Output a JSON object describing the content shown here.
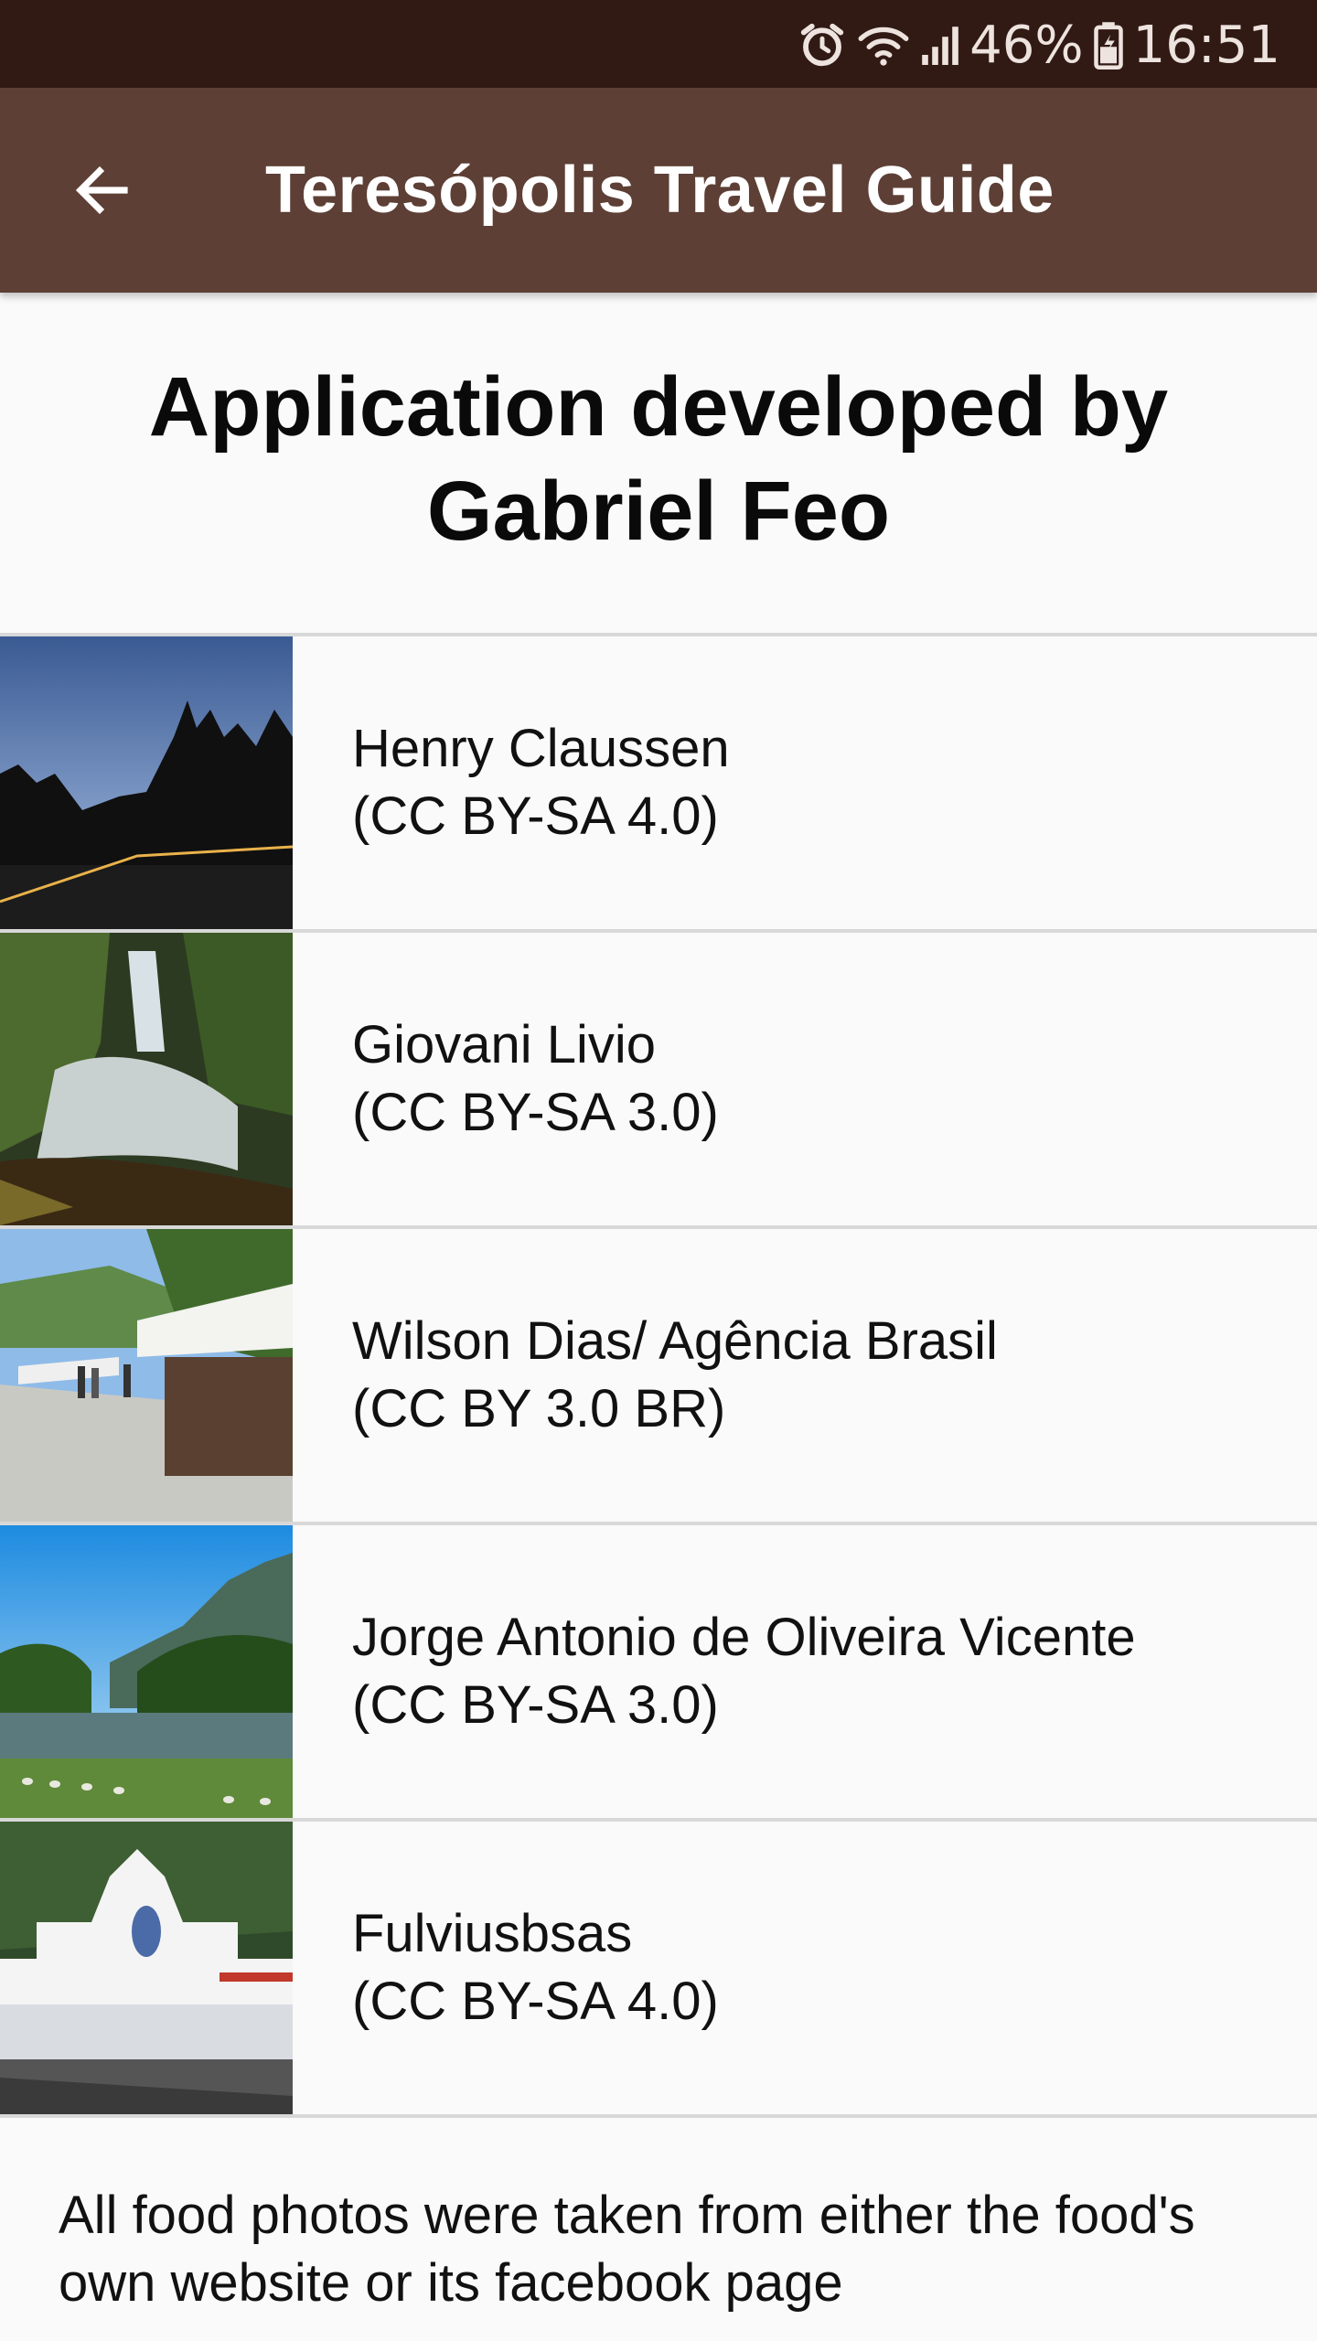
{
  "status_bar": {
    "battery": "46%",
    "time": "16:51"
  },
  "app_bar": {
    "title": "Teresópolis Travel Guide"
  },
  "heading": {
    "line1": "Application developed by",
    "line2": "Gabriel Feo"
  },
  "credits": [
    {
      "author": "Henry Claussen",
      "license": "(CC BY-SA 4.0)"
    },
    {
      "author": "Giovani Livio",
      "license": "(CC BY-SA 3.0)"
    },
    {
      "author": "Wilson Dias/ Agência Brasil",
      "license": "(CC BY 3.0 BR)"
    },
    {
      "author": "Jorge Antonio de Oliveira Vicente",
      "license": "(CC BY-SA 3.0)"
    },
    {
      "author": "Fulviusbsas",
      "license": "(CC BY-SA 4.0)"
    }
  ],
  "footer_note": "All food photos were taken from either the food's own website or its facebook page",
  "colors": {
    "status_bar": "#321a14",
    "app_bar": "#5d3f35",
    "background": "#fafafa"
  },
  "icons": {
    "back": "arrow-left-icon",
    "alarm": "alarm-icon",
    "wifi": "wifi-icon",
    "signal": "signal-icon",
    "battery": "battery-icon"
  }
}
